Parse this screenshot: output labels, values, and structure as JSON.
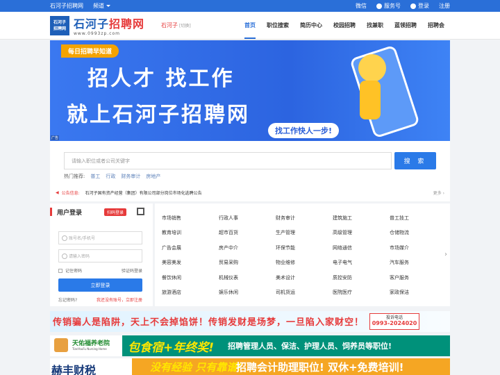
{
  "topbar": {
    "site": "石河子招聘网",
    "channel": "频道",
    "wechat": "微信",
    "service": "服务号",
    "login": "登录",
    "register": "注册"
  },
  "header": {
    "logo_box_l1": "石河子",
    "logo_box_l2": "招聘网",
    "logo_cn_a": "石河子",
    "logo_cn_b": "招聘网",
    "logo_url": "www.0993zp.com",
    "city": "石河子",
    "city_switch": "[切换]"
  },
  "nav": [
    "首页",
    "职位搜索",
    "简历中心",
    "校园招聘",
    "找兼职",
    "蓝领招聘",
    "招聘会"
  ],
  "banner": {
    "tag": "每日招聘早知道",
    "h1": "招人才 找工作",
    "h2": "就上石河子招聘网",
    "pill": "找工作快人一步!",
    "ad": "广告"
  },
  "search": {
    "placeholder": "请输入职位或者公司关键字",
    "button": "搜 索",
    "hot_label": "热门推荐:",
    "hot": [
      "普工",
      "行政",
      "财务审计",
      "房地产"
    ]
  },
  "notice": {
    "label": "公告信息:",
    "text": "石河子国有资产经营（集团）有限公司部分岗位市场化选聘公告",
    "more": "更多 ›"
  },
  "login": {
    "title": "用户登录",
    "scan": "扫码登录",
    "user_ph": "账号名/手机号",
    "pwd_ph": "请输入密码",
    "remember": "记住密码",
    "code_login": "验证码登录",
    "button": "立即登录",
    "forgot": "忘记密码?",
    "no_account": "我还没有账号，立即注册"
  },
  "categories": [
    "市场销售",
    "行政人事",
    "财务审计",
    "建筑施工",
    "普工技工",
    "教育培训",
    "超市百货",
    "生产管理",
    "高级管理",
    "仓储物流",
    "广告会展",
    "房产中介",
    "环保节能",
    "网络通信",
    "市场媒介",
    "美容美发",
    "贸易采购",
    "物业维修",
    "电子电气",
    "汽车服务",
    "餐饮休闲",
    "机械仪表",
    "美术设计",
    "质控安防",
    "客户服务",
    "旅游酒店",
    "娱乐休闲",
    "司机货运",
    "医院医疗",
    "家政保洁"
  ],
  "ads": {
    "ad1_text": "传销骗人是陷阱，天上不会掉馅饼！传销发财是场梦，一旦陷入家财空！",
    "ad1_tel_label": "投诉电话",
    "ad1_tel": "0993-2024020",
    "ad2_org": "天佑福养老院",
    "ad2_org_en": "TianYouFu Nursing Home",
    "ad2_yel": "包食宿+年终奖!",
    "ad2_wh": "招聘管理人员、保洁、护理人员、饲养员等职位!",
    "ad3_brand": "赫丰财税",
    "ad3_yel": "没有经验 只有靠谱!",
    "ad3_wh": "招聘会计助理职位! 双休+免费培训!"
  },
  "colors": {
    "primary": "#2a6fd8",
    "accent": "#e63a3a",
    "button": "#2a7ae8"
  }
}
